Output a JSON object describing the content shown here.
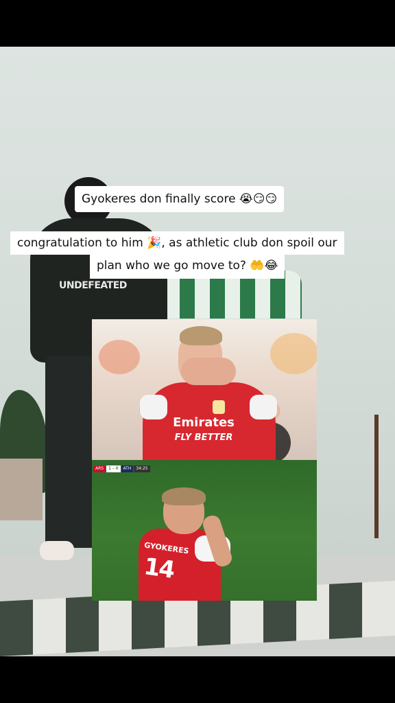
{
  "captions": {
    "line1": "Gyokeres don finally score 😭😏😏",
    "line2": "congratulation to him 🎉, as athletic club don spoil our",
    "line3": "plan who we go move to? 🤲😂"
  },
  "photo_top": {
    "sponsor_main": "Emirates",
    "sponsor_sub": "FLY BETTER"
  },
  "photo_bottom": {
    "scorebug": {
      "home": "ARS",
      "score": "1 – 0",
      "away": "ATH",
      "time": "34:25"
    },
    "shirt_name": "GYOKERES",
    "shirt_number": "14"
  },
  "background": {
    "shirt_text": "UNDEFEATED"
  },
  "colors": {
    "arsenal_red": "#d7282f",
    "caption_bg": "#ffffff",
    "pitch_green": "#3c7a30"
  }
}
